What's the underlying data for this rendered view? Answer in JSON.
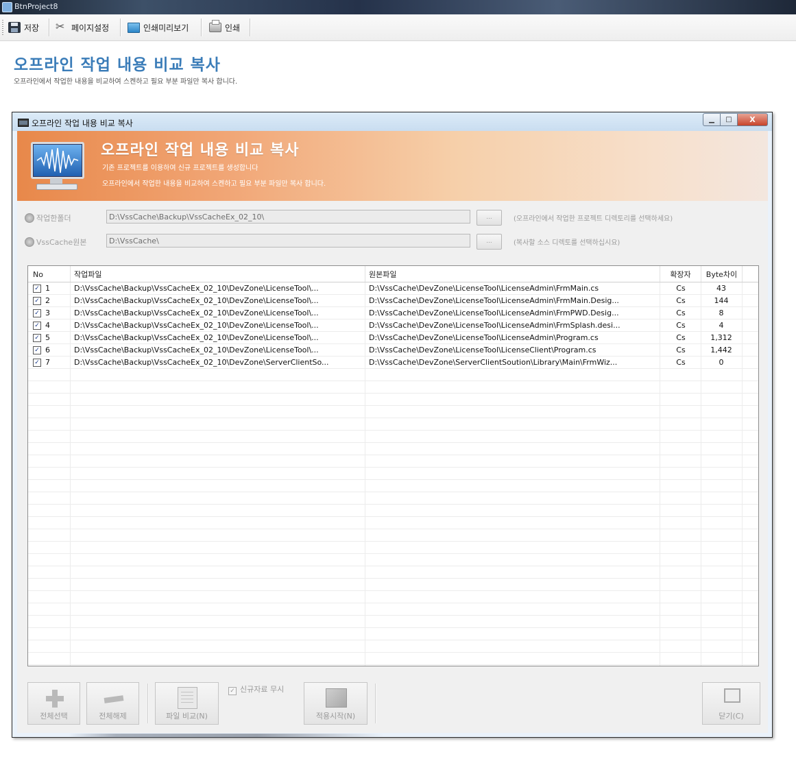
{
  "app": {
    "title": "BtnProject8"
  },
  "toolbar": {
    "save": "저장",
    "page_setup": "페이지설정",
    "print_preview": "인쇄미리보기",
    "print": "인쇄"
  },
  "page": {
    "title": "오프라인 작업 내용 비교 복사",
    "subtitle": "오프라인에서 작업한 내용을 비교하여 스켄하고 필요 부분 파일만 복사 합니다."
  },
  "window": {
    "title": "오프라인 작업 내용 비교 복사",
    "close_glyph": "X"
  },
  "banner": {
    "title": "오프라인 작업 내용 비교 복사",
    "line1": "기존 프로젝트를 이용하여 신규 프로젝트를 생성합니다",
    "line2": "오프라인에서 작업한 내용을 비교하여 스켄하고 필요 부분 파일만 복사 합니다."
  },
  "form": {
    "work_folder": {
      "label": "작업한폴더",
      "value": "D:\\VssCache\\Backup\\VssCacheEx_02_10\\",
      "browse": "...",
      "hint": "(오프라인에서 작업한 프로젝트 디렉토리를 선택하세요)"
    },
    "source": {
      "label": "VssCache원본",
      "value": "D:\\VssCache\\",
      "browse": "...",
      "hint": "(복사할 소스 디렉토를 선택하십시요)"
    }
  },
  "grid": {
    "columns": [
      "No",
      "작업파일",
      "원본파일",
      "확장자",
      "Byte차이"
    ],
    "rows": [
      {
        "checked": true,
        "no": "1",
        "work": "D:\\VssCache\\Backup\\VssCacheEx_02_10\\DevZone\\LicenseTool\\...",
        "orig": "D:\\VssCache\\DevZone\\LicenseTool\\LicenseAdmin\\FrmMain.cs",
        "ext": "Cs",
        "diff": "43"
      },
      {
        "checked": true,
        "no": "2",
        "work": "D:\\VssCache\\Backup\\VssCacheEx_02_10\\DevZone\\LicenseTool\\...",
        "orig": "D:\\VssCache\\DevZone\\LicenseTool\\LicenseAdmin\\FrmMain.Desig...",
        "ext": "Cs",
        "diff": "144"
      },
      {
        "checked": true,
        "no": "3",
        "work": "D:\\VssCache\\Backup\\VssCacheEx_02_10\\DevZone\\LicenseTool\\...",
        "orig": "D:\\VssCache\\DevZone\\LicenseTool\\LicenseAdmin\\FrmPWD.Desig...",
        "ext": "Cs",
        "diff": "8"
      },
      {
        "checked": true,
        "no": "4",
        "work": "D:\\VssCache\\Backup\\VssCacheEx_02_10\\DevZone\\LicenseTool\\...",
        "orig": "D:\\VssCache\\DevZone\\LicenseTool\\LicenseAdmin\\FrmSplash.desi...",
        "ext": "Cs",
        "diff": "4"
      },
      {
        "checked": true,
        "no": "5",
        "work": "D:\\VssCache\\Backup\\VssCacheEx_02_10\\DevZone\\LicenseTool\\...",
        "orig": "D:\\VssCache\\DevZone\\LicenseTool\\LicenseAdmin\\Program.cs",
        "ext": "Cs",
        "diff": "1,312"
      },
      {
        "checked": true,
        "no": "6",
        "work": "D:\\VssCache\\Backup\\VssCacheEx_02_10\\DevZone\\LicenseTool\\...",
        "orig": "D:\\VssCache\\DevZone\\LicenseTool\\LicenseClient\\Program.cs",
        "ext": "Cs",
        "diff": "1,442"
      },
      {
        "checked": true,
        "no": "7",
        "work": "D:\\VssCache\\Backup\\VssCacheEx_02_10\\DevZone\\ServerClientSo...",
        "orig": "D:\\VssCache\\DevZone\\ServerClientSoution\\Library\\Main\\FrmWiz...",
        "ext": "Cs",
        "diff": "0"
      }
    ]
  },
  "buttons": {
    "select_all": "전체선택",
    "deselect_all": "전체해제",
    "compare": "파일 비교(N)",
    "ignore_new": "신규자료 무시",
    "apply": "적용시작(N)",
    "close": "닫기(C)"
  },
  "colors": {
    "page_title": "#3a7cb8",
    "banner_start": "#e8884a",
    "banner_end": "#f3e6de"
  }
}
